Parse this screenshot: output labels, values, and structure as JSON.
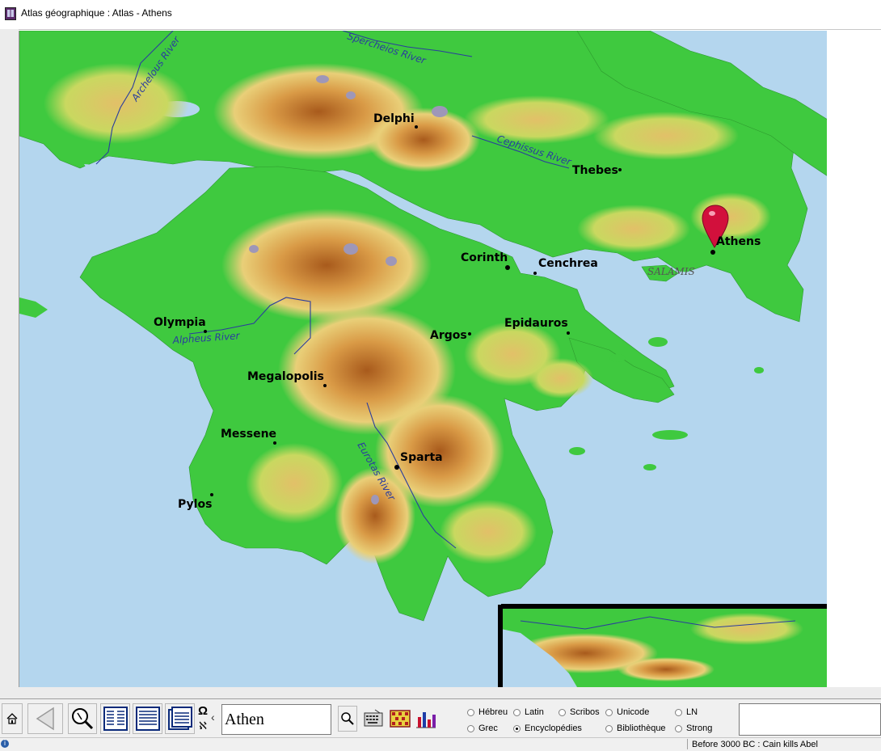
{
  "window": {
    "title": "Atlas géographique : Atlas - Athens"
  },
  "map": {
    "cities": [
      {
        "name": "Delphi"
      },
      {
        "name": "Thebes"
      },
      {
        "name": "Athens"
      },
      {
        "name": "Corinth"
      },
      {
        "name": "Cenchrea"
      },
      {
        "name": "Olympia"
      },
      {
        "name": "Argos"
      },
      {
        "name": "Epidauros"
      },
      {
        "name": "Megalopolis"
      },
      {
        "name": "Messene"
      },
      {
        "name": "Sparta"
      },
      {
        "name": "Pylos"
      }
    ],
    "rivers": [
      {
        "name": "Archelous River"
      },
      {
        "name": "Spercheios River"
      },
      {
        "name": "Cephissus River"
      },
      {
        "name": "Alpheus River"
      },
      {
        "name": "Eurotas River"
      }
    ],
    "islands": [
      {
        "name": "SALAMIS"
      }
    ],
    "colors": {
      "sea": "#b4d6ee",
      "lowland": "#3fc93f",
      "hill": "#e8c46a",
      "mountain": "#b4641e",
      "peak": "#9e97b8",
      "river": "#2a3c9e",
      "marker": "#d2103c"
    }
  },
  "toolbar": {
    "search_value": "Athen",
    "omega_label": "Ω",
    "aleph_label": "ℵ",
    "chevron_label": "‹",
    "radios": [
      {
        "label": "Hébreu",
        "checked": false
      },
      {
        "label": "Latin",
        "checked": false
      },
      {
        "label": "Scribos",
        "checked": false
      },
      {
        "label": "Unicode",
        "checked": false
      },
      {
        "label": "LN",
        "checked": false
      },
      {
        "label": "Grec",
        "checked": false
      },
      {
        "label": "Encyclopédies",
        "checked": true
      },
      {
        "label": "Bibliothèque",
        "checked": false
      },
      {
        "label": "Strong",
        "checked": false
      }
    ]
  },
  "status": {
    "info_label": "i",
    "text": "Before 3000 BC : Cain kills Abel"
  }
}
